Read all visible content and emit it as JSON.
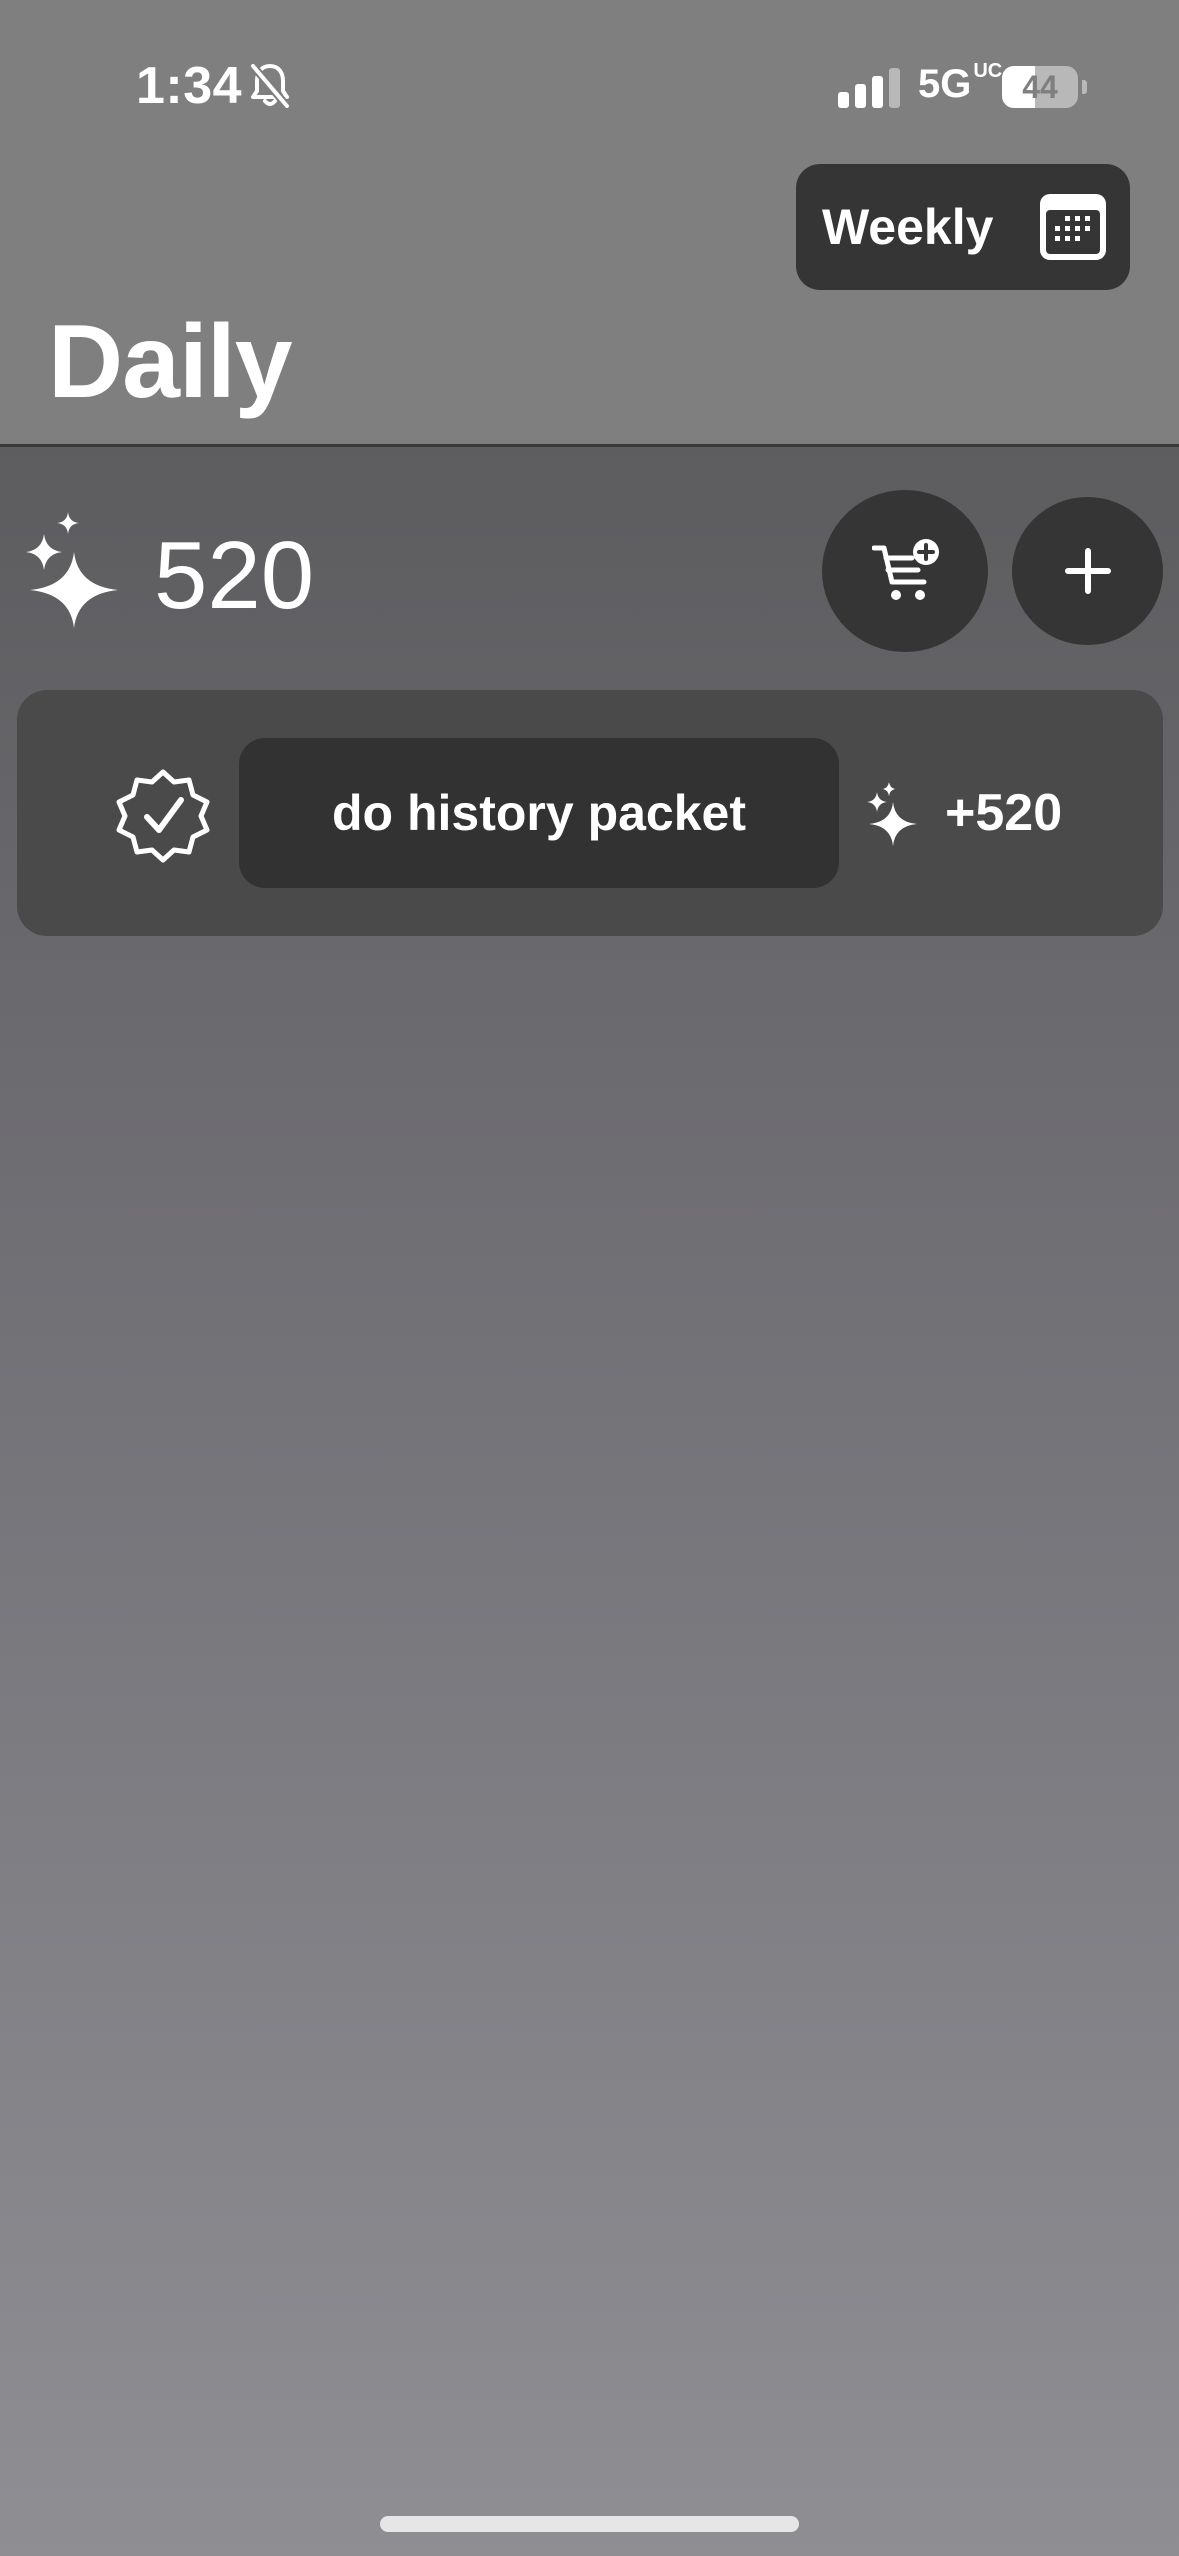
{
  "status_bar": {
    "time": "1:34",
    "network": "5G",
    "network_badge": "UC",
    "battery_level": "44",
    "battery_fraction": 0.44
  },
  "header": {
    "weekly_button_label": "Weekly",
    "page_title": "Daily"
  },
  "balance": {
    "value": "520",
    "icon": "sparkles-icon"
  },
  "actions": {
    "shop_icon": "cart-plus-icon",
    "add_icon": "plus-icon"
  },
  "tasks": [
    {
      "label": "do history packet",
      "reward": "+520",
      "status_icon": "checkmark-seal-icon",
      "reward_icon": "sparkles-icon"
    }
  ],
  "colors": {
    "header_bg": "#7f7f7f",
    "button_bg": "#353535",
    "card_bg": "#4a4a4a",
    "text": "#ffffff"
  }
}
